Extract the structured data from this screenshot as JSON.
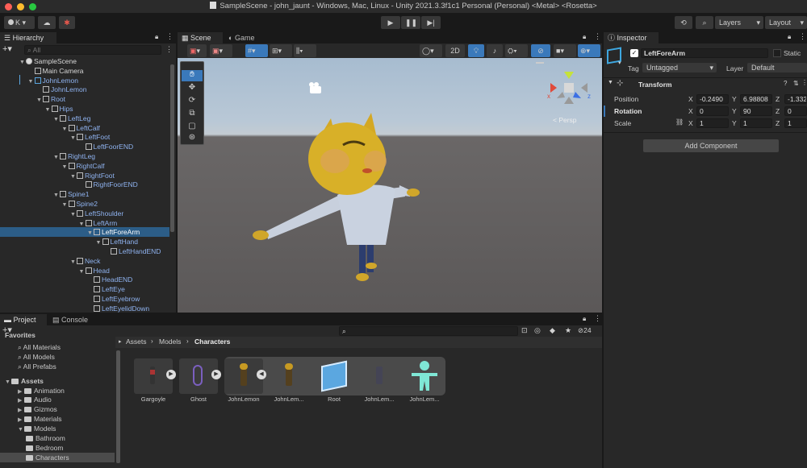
{
  "window": {
    "title": "SampleScene - john_jaunt - Windows, Mac, Linux - Unity 2021.3.3f1c1 Personal (Personal) <Metal> <Rosetta>"
  },
  "toolbar": {
    "account": "K",
    "layers": "Layers",
    "layout": "Layout"
  },
  "hierarchy": {
    "tab": "Hierarchy",
    "search_placeholder": "All",
    "rows": [
      {
        "label": "SampleScene",
        "indent": 0,
        "arrow": "▼",
        "icon": "unity",
        "color": "#d8d8d8"
      },
      {
        "label": "Main Camera",
        "indent": 1,
        "arrow": "",
        "icon": "cube",
        "color": "#d8d8d8"
      },
      {
        "label": "JohnLemon",
        "indent": 1,
        "arrow": "▼",
        "icon": "cube",
        "color": "#8fb3f0"
      },
      {
        "label": "JohnLemon",
        "indent": 2,
        "arrow": "",
        "icon": "cube",
        "color": "#8fb3f0"
      },
      {
        "label": "Root",
        "indent": 2,
        "arrow": "▼",
        "icon": "cube",
        "color": "#8fb3f0"
      },
      {
        "label": "Hips",
        "indent": 3,
        "arrow": "▼",
        "icon": "cube",
        "color": "#8fb3f0"
      },
      {
        "label": "LeftLeg",
        "indent": 4,
        "arrow": "▼",
        "icon": "cube",
        "color": "#8fb3f0"
      },
      {
        "label": "LeftCalf",
        "indent": 5,
        "arrow": "▼",
        "icon": "cube",
        "color": "#8fb3f0"
      },
      {
        "label": "LeftFoot",
        "indent": 6,
        "arrow": "▼",
        "icon": "cube",
        "color": "#8fb3f0"
      },
      {
        "label": "LeftFoorEND",
        "indent": 7,
        "arrow": "",
        "icon": "cube",
        "color": "#8fb3f0"
      },
      {
        "label": "RightLeg",
        "indent": 4,
        "arrow": "▼",
        "icon": "cube",
        "color": "#8fb3f0"
      },
      {
        "label": "RightCalf",
        "indent": 5,
        "arrow": "▼",
        "icon": "cube",
        "color": "#8fb3f0"
      },
      {
        "label": "RightFoot",
        "indent": 6,
        "arrow": "▼",
        "icon": "cube",
        "color": "#8fb3f0"
      },
      {
        "label": "RightFoorEND",
        "indent": 7,
        "arrow": "",
        "icon": "cube",
        "color": "#8fb3f0"
      },
      {
        "label": "Spine1",
        "indent": 4,
        "arrow": "▼",
        "icon": "cube",
        "color": "#8fb3f0"
      },
      {
        "label": "Spine2",
        "indent": 5,
        "arrow": "▼",
        "icon": "cube",
        "color": "#8fb3f0"
      },
      {
        "label": "LeftShoulder",
        "indent": 6,
        "arrow": "▼",
        "icon": "cube",
        "color": "#8fb3f0"
      },
      {
        "label": "LeftArm",
        "indent": 7,
        "arrow": "▼",
        "icon": "cube",
        "color": "#8fb3f0"
      },
      {
        "label": "LeftForeArm",
        "indent": 8,
        "arrow": "▼",
        "icon": "cube",
        "color": "#ffffff",
        "selected": true
      },
      {
        "label": "LeftHand",
        "indent": 9,
        "arrow": "▼",
        "icon": "cube",
        "color": "#8fb3f0"
      },
      {
        "label": "LeftHandEND",
        "indent": 10,
        "arrow": "",
        "icon": "cube",
        "color": "#8fb3f0"
      },
      {
        "label": "Neck",
        "indent": 6,
        "arrow": "▼",
        "icon": "cube",
        "color": "#8fb3f0"
      },
      {
        "label": "Head",
        "indent": 7,
        "arrow": "▼",
        "icon": "cube",
        "color": "#8fb3f0"
      },
      {
        "label": "HeadEND",
        "indent": 8,
        "arrow": "",
        "icon": "cube",
        "color": "#8fb3f0"
      },
      {
        "label": "LeftEye",
        "indent": 8,
        "arrow": "",
        "icon": "cube",
        "color": "#8fb3f0"
      },
      {
        "label": "LeftEyebrow",
        "indent": 8,
        "arrow": "",
        "icon": "cube",
        "color": "#8fb3f0"
      },
      {
        "label": "LeftEyelidDown",
        "indent": 8,
        "arrow": "",
        "icon": "cube",
        "color": "#8fb3f0"
      }
    ]
  },
  "scene": {
    "tab_scene": "Scene",
    "tab_game": "Game",
    "mode_2d": "2D",
    "persp": "< Persp",
    "gizmo_x": "x",
    "gizmo_z": "z"
  },
  "inspector": {
    "tab": "Inspector",
    "object_name": "LeftForeArm",
    "static_label": "Static",
    "tag_label": "Tag",
    "tag_value": "Untagged",
    "layer_label": "Layer",
    "layer_value": "Default",
    "component": "Transform",
    "position": {
      "label": "Position",
      "x": "-0.2490",
      "y": "6.98808",
      "z": "-1.332"
    },
    "rotation": {
      "label": "Rotation",
      "x": "0",
      "y": "90",
      "z": "0"
    },
    "scale": {
      "label": "Scale",
      "x": "1",
      "y": "1",
      "z": "1"
    },
    "axis_x": "X",
    "axis_y": "Y",
    "axis_z": "Z",
    "add_component": "Add Component"
  },
  "project": {
    "tab_project": "Project",
    "tab_console": "Console",
    "hidden_count": "24",
    "breadcrumb": [
      "Assets",
      "Models",
      "Characters"
    ],
    "sidebar": [
      {
        "label": "Favorites",
        "kind": "header"
      },
      {
        "label": "All Materials",
        "kind": "search"
      },
      {
        "label": "All Models",
        "kind": "search"
      },
      {
        "label": "All Prefabs",
        "kind": "search"
      },
      {
        "label": "Assets",
        "kind": "root"
      },
      {
        "label": "Animation",
        "kind": "folder",
        "indent": 1
      },
      {
        "label": "Audio",
        "kind": "folder",
        "indent": 1
      },
      {
        "label": "Gizmos",
        "kind": "folder",
        "indent": 1
      },
      {
        "label": "Materials",
        "kind": "folder",
        "indent": 1
      },
      {
        "label": "Models",
        "kind": "folder-open",
        "indent": 1
      },
      {
        "label": "Bathroom",
        "kind": "folder",
        "indent": 2
      },
      {
        "label": "Bedroom",
        "kind": "folder",
        "indent": 2
      },
      {
        "label": "Characters",
        "kind": "folder",
        "indent": 2,
        "selected": true
      }
    ],
    "assets": [
      "Gargoyle",
      "Ghost",
      "JohnLemon",
      "JohnLem...",
      "Root",
      "JohnLem...",
      "JohnLem..."
    ]
  },
  "colors": {
    "selection": "#2c5d87",
    "accent": "#3a79bb",
    "sky": "#a9bccf",
    "ground": "#5b5858"
  }
}
